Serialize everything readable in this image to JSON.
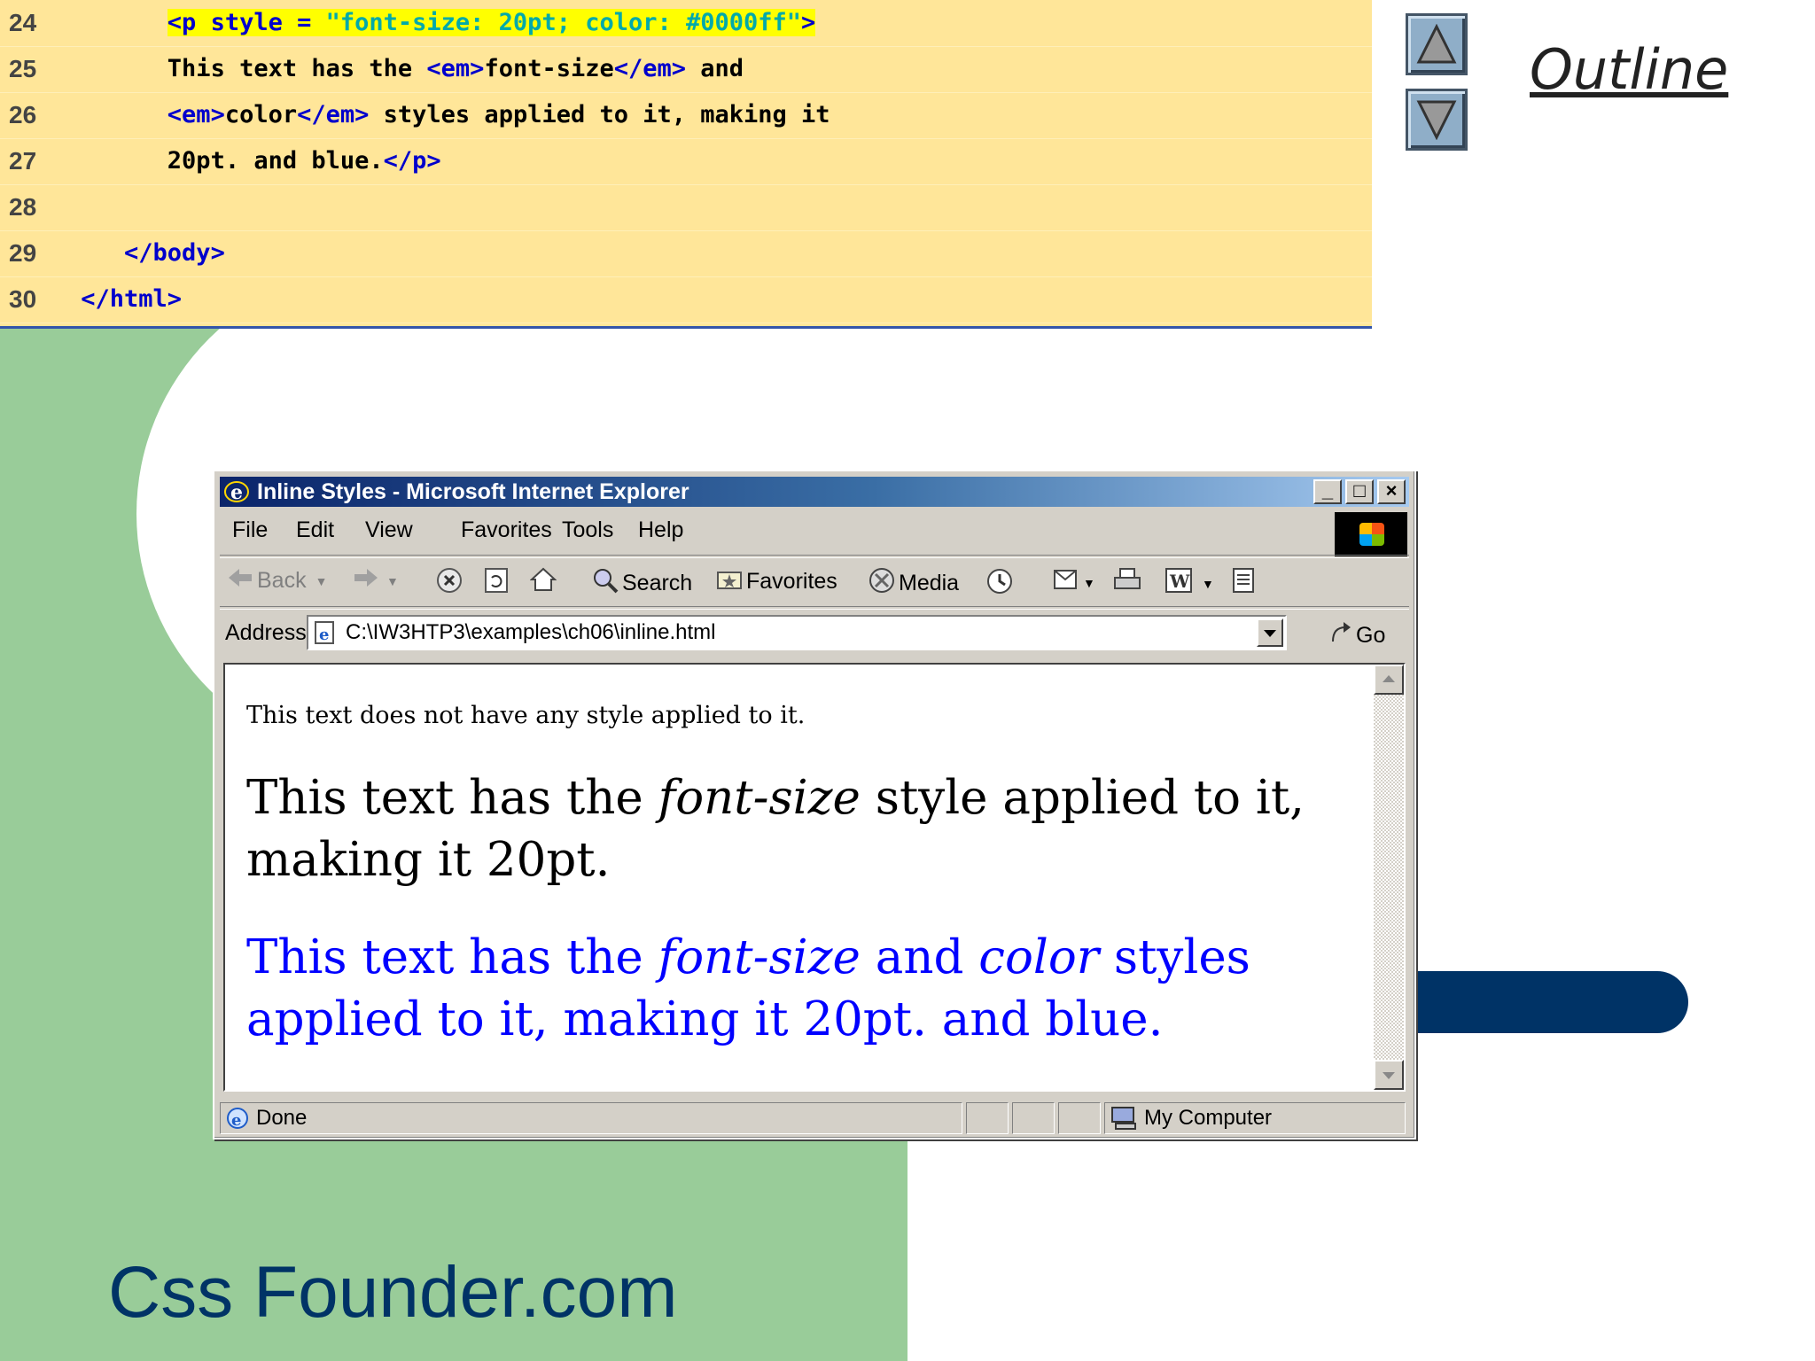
{
  "colors": {
    "slide_green": "#99cc99",
    "code_bg": "#ffe699",
    "tag_blue": "#0000cc",
    "brand_navy": "#003366",
    "rendered_blue": "#0000ff"
  },
  "code": {
    "lines": [
      {
        "num": "24",
        "indent": "       ",
        "parts": [
          {
            "t": "<p style = ",
            "c": "tag hi"
          },
          {
            "t": "\"font-size: 20pt; color: #0000ff\"",
            "c": "str hi"
          },
          {
            "t": ">",
            "c": "tag hi"
          }
        ]
      },
      {
        "num": "25",
        "indent": "       ",
        "parts": [
          {
            "t": "This text has the ",
            "c": ""
          },
          {
            "t": "<em>",
            "c": "tag"
          },
          {
            "t": "font-size",
            "c": ""
          },
          {
            "t": "</em>",
            "c": "tag"
          },
          {
            "t": " and",
            "c": ""
          }
        ]
      },
      {
        "num": "26",
        "indent": "       ",
        "parts": [
          {
            "t": "<em>",
            "c": "tag"
          },
          {
            "t": "color",
            "c": ""
          },
          {
            "t": "</em>",
            "c": "tag"
          },
          {
            "t": " styles applied to it, making it",
            "c": ""
          }
        ]
      },
      {
        "num": "27",
        "indent": "       ",
        "parts": [
          {
            "t": "20pt. and blue.",
            "c": ""
          },
          {
            "t": "</p>",
            "c": "tag"
          }
        ]
      },
      {
        "num": "28",
        "indent": "",
        "parts": []
      },
      {
        "num": "29",
        "indent": "    ",
        "parts": [
          {
            "t": "</body>",
            "c": "tag"
          }
        ]
      },
      {
        "num": "30",
        "indent": " ",
        "parts": [
          {
            "t": "</html>",
            "c": "tag"
          }
        ]
      }
    ]
  },
  "outline": {
    "title": "Outline",
    "up_icon": "triangle-up-icon",
    "down_icon": "triangle-down-icon"
  },
  "browser": {
    "title": "Inline Styles - Microsoft Internet Explorer",
    "menu": [
      "File",
      "Edit",
      "View",
      "Favorites",
      "Tools",
      "Help"
    ],
    "toolbar": {
      "back": "Back",
      "search": "Search",
      "favorites": "Favorites",
      "media": "Media"
    },
    "address_label": "Address",
    "address_value": "C:\\IW3HTP3\\examples\\ch06\\inline.html",
    "go_label": "Go",
    "content": {
      "p1": "This text does not have any style applied to it.",
      "p2": {
        "a": "This text has the ",
        "em": "font-size",
        "b": " style applied to it, making it 20pt."
      },
      "p3": {
        "a": "This text has the ",
        "em1": "font-size",
        "b": " and ",
        "em2": "color",
        "c": " styles applied to it, making it 20pt. and blue."
      }
    },
    "status": {
      "left": "Done",
      "zone": "My Computer"
    }
  },
  "footer": {
    "brand": "Css Founder.com"
  }
}
